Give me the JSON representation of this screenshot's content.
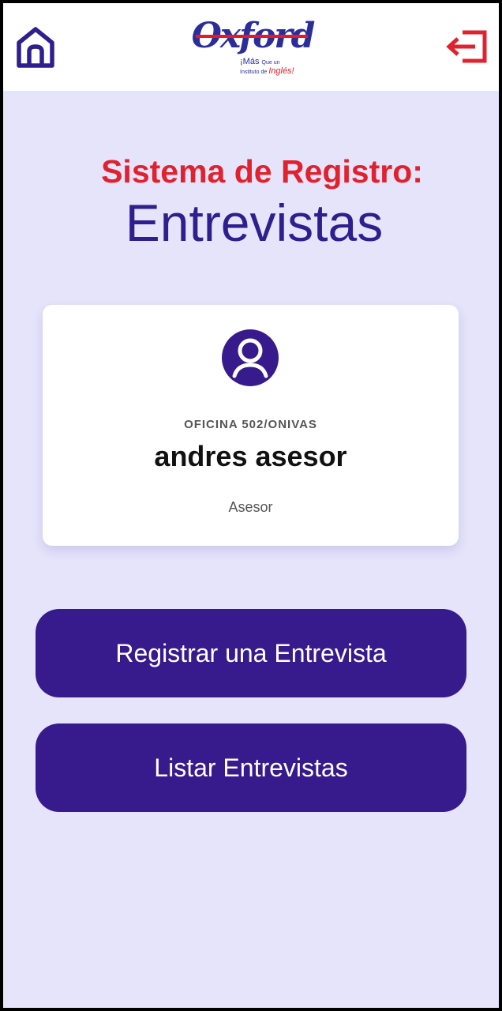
{
  "header": {
    "home_icon": "home-icon",
    "logout_icon": "logout-icon",
    "logo": {
      "brand": "Oxford",
      "tagline_word1": "¡Más",
      "tagline_word2": "Que un",
      "tagline_word3": "Instituto de",
      "tagline_word4": "Inglés!"
    }
  },
  "title": {
    "line1": "Sistema de Registro:",
    "line2": "Entrevistas"
  },
  "profile_card": {
    "avatar_icon": "user-avatar-icon",
    "office": "OFICINA 502/ONIVAS",
    "name": "andres asesor",
    "role": "Asesor"
  },
  "actions": {
    "register_label": "Registrar una Entrevista",
    "list_label": "Listar Entrevistas"
  },
  "colors": {
    "primary": "#371b8c",
    "accent_red": "#e0212e",
    "background": "#e5e4fb",
    "title_blue": "#2f1f8e"
  }
}
